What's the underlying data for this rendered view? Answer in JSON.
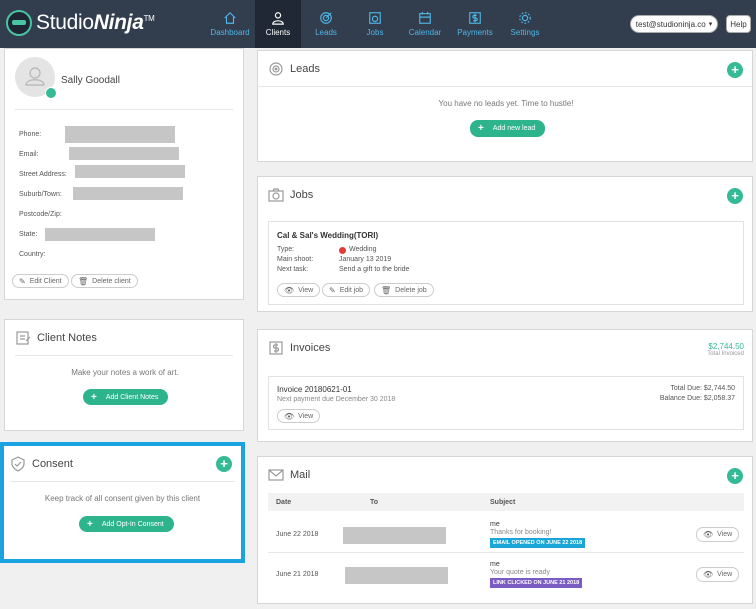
{
  "brand": {
    "name_a": "Studio",
    "name_b": "Ninja",
    "tm": "TM"
  },
  "nav": [
    {
      "label": "Dashboard",
      "icon": "home-icon"
    },
    {
      "label": "Clients",
      "icon": "user-icon",
      "active": true
    },
    {
      "label": "Leads",
      "icon": "target-icon"
    },
    {
      "label": "Jobs",
      "icon": "camera-icon"
    },
    {
      "label": "Calendar",
      "icon": "calendar-icon"
    },
    {
      "label": "Payments",
      "icon": "dollar-icon"
    },
    {
      "label": "Settings",
      "icon": "gear-icon"
    }
  ],
  "account": {
    "email": "test@studioninja.co",
    "help": "Help"
  },
  "client": {
    "name": "Sally Goodall",
    "fields": {
      "phone": "Phone:",
      "email": "Email:",
      "street": "Street Address:",
      "suburb": "Suburb/Town:",
      "postcode": "Postcode/Zip:",
      "state": "State:",
      "country": "Country:"
    },
    "edit_label": "Edit Client",
    "delete_label": "Delete client"
  },
  "notes": {
    "title": "Client Notes",
    "empty": "Make your notes a work of art.",
    "button": "Add Client Notes"
  },
  "consent": {
    "title": "Consent",
    "empty": "Keep track of all consent given by this client",
    "button": "Add Opt-In Consent"
  },
  "leads": {
    "title": "Leads",
    "empty": "You have no leads yet. Time to hustle!",
    "button": "Add new lead"
  },
  "jobs": {
    "title": "Jobs",
    "job_title": "Cal & Sal's Wedding(TORI)",
    "type_label": "Type:",
    "type_value": "Wedding",
    "main_shoot_label": "Main shoot:",
    "main_shoot_value": "January 13 2019",
    "next_task_label": "Next task:",
    "next_task_value": "Send a gift to the bride",
    "view": "View",
    "edit": "Edit job",
    "delete": "Delete job",
    "status_color": "#e53935"
  },
  "invoices": {
    "title": "Invoices",
    "total": "$2,744.50",
    "total_label": "Total Invoiced",
    "invoice_id": "Invoice 20180621-01",
    "next_payment": "Next payment due December 30 2018",
    "total_due": "Total Due: $2,744.50",
    "balance_due": "Balance Due: $2,058.37",
    "view": "View"
  },
  "mail": {
    "title": "Mail",
    "columns": {
      "date": "Date",
      "to": "To",
      "subject": "Subject"
    },
    "rows": [
      {
        "date": "June 22 2018",
        "from": "me",
        "subject": "Thanks for booking!",
        "badge": "EMAIL OPENED ON JUNE 22 2018",
        "badge_color": "#1aa6d6",
        "view": "View"
      },
      {
        "date": "June 21 2018",
        "from": "me",
        "subject": "Your quote is ready",
        "badge": "LINK CLICKED ON JUNE 21 2018",
        "badge_color": "#7a5cc2",
        "view": "View"
      }
    ]
  },
  "colors": {
    "accent": "#35ba96",
    "nav_bg": "#323d4e",
    "highlight": "#1aa3e0"
  }
}
